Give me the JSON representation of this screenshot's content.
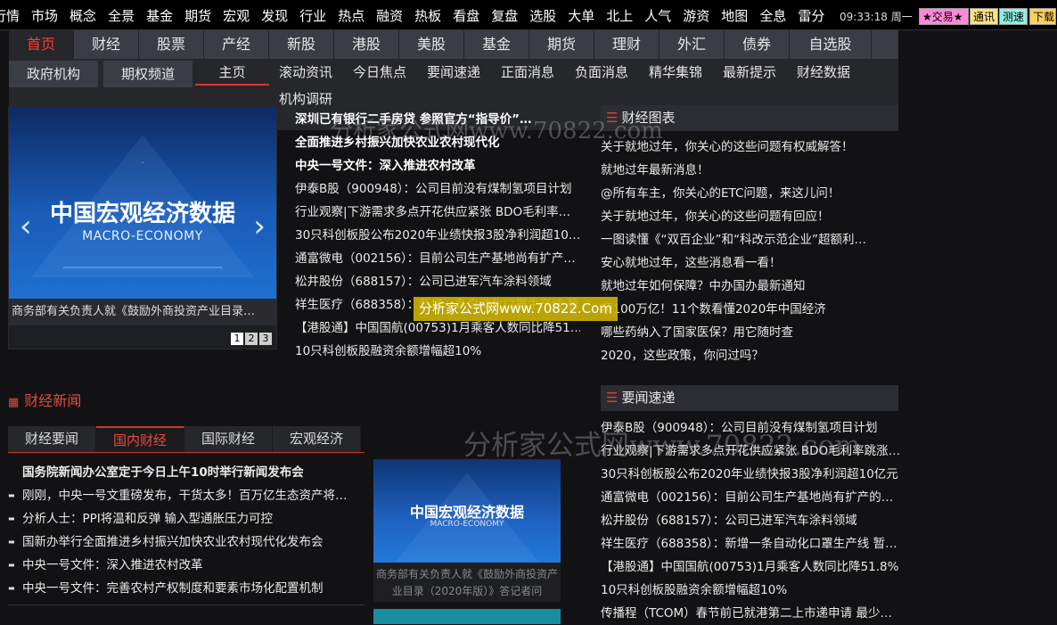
{
  "topbar": {
    "nav": [
      "行情",
      "市场",
      "概念",
      "全景",
      "基金",
      "期货",
      "宏观",
      "发现",
      "行业",
      "热点",
      "融资",
      "热板",
      "看盘",
      "复盘",
      "选股",
      "大单",
      "北上",
      "人气",
      "游资",
      "地图",
      "全息",
      "雷分"
    ],
    "clock": "09:33:18 周一",
    "badges": [
      {
        "label": "★交易★",
        "bg": "#ff88d8"
      },
      {
        "label": "通讯",
        "bg": "#ffe07a"
      },
      {
        "label": "测速",
        "bg": "#8ff0e0"
      },
      {
        "label": "下载",
        "bg": "#ffd060"
      }
    ]
  },
  "main_tabs": [
    "首页",
    "财经",
    "股票",
    "产经",
    "新股",
    "港股",
    "美股",
    "基金",
    "期货",
    "理财",
    "外汇",
    "债券",
    "自选股"
  ],
  "sub_tabs": {
    "box1": "政府机构",
    "box2": "期权频道",
    "items": [
      "主页",
      "滚动资讯",
      "今日焦点",
      "要闻速递",
      "正面消息",
      "负面消息",
      "精华集锦",
      "最新提示",
      "财经数据"
    ],
    "row2": "机构调研"
  },
  "slideshow": {
    "title": "中国宏观经济数据",
    "subtitle": "MACRO-ECONOMY",
    "caption": "商务部有关负责人就《鼓励外商投资产业目录…",
    "pages": [
      "1",
      "2",
      "3"
    ]
  },
  "headlines": [
    {
      "text": "深圳已有银行二手房贷 参照官方“指导价”…",
      "bold": true
    },
    {
      "text": "全面推进乡村振兴加快农业农村现代化",
      "bold": true
    },
    {
      "text": "中央一号文件：深入推进农村改革",
      "bold": true
    },
    {
      "text": "伊泰B股（900948）：公司目前没有煤制氢项目计划",
      "bold": false
    },
    {
      "text": "行业观察|下游需求多点开花供应紧张 BDO毛利率…",
      "bold": false
    },
    {
      "text": "30只科创板股公布2020年业绩快报3股净利润超10…",
      "bold": false
    },
    {
      "text": "通富微电（002156）：目前公司生产基地尚有扩产…",
      "bold": false
    },
    {
      "text": "松井股份（688157）：公司已进军汽车涂料领域",
      "bold": false
    },
    {
      "text": "祥生医疗（688358）：新增一条自动化口罩生产线 暂…",
      "bold": false
    },
    {
      "text": "【港股通】中国国航(00753)1月乘客人数同比降51…",
      "bold": false
    },
    {
      "text": "10只科创板股融资余额增幅超10%",
      "bold": false
    }
  ],
  "charts_section": {
    "title": "财经图表",
    "items": [
      "关于就地过年，你关心的这些问题有权威解答！",
      "就地过年最新消息！",
      "@所有车主，你关心的ETC问题，来这儿问！",
      "关于就地过年，你关心的这些问题有回应！",
      "一图读懂《“双百企业”和“科改示范企业”超额利…",
      "安心就地过年，这些消息看一看！",
      "就地过年如何保障？中办国办最新通知",
      "超100万亿！11个数看懂2020年中国经济",
      "哪些药纳入了国家医保？用它随时查",
      "2020，这些政策，你问过吗？"
    ]
  },
  "express_section": {
    "title": "要闻速递",
    "items": [
      "伊泰B股（900948）：公司目前没有煤制氢项目计划",
      "行业观察|下游需求多点开花供应紧张 BDO毛利率跳涨…",
      "30只科创板股公布2020年业绩快报3股净利润超10亿元",
      "通富微电（002156）：目前公司生产基地尚有扩产的…",
      "松井股份（688157）：公司已进军汽车涂料领域",
      "祥生医疗（688358）：新增一条自动化口罩生产线 暂…",
      "【港股通】中国国航(00753)1月乘客人数同比降51.8%",
      "10只科创板股融资余额增幅超10%",
      "传播程（TCOM）春节前已就港第二上市递申请 最少…"
    ]
  },
  "finance_news": {
    "title": "财经新闻",
    "tabs": [
      "财经要闻",
      "国内财经",
      "国际财经",
      "宏观经济"
    ],
    "items": [
      {
        "text": "国务院新闻办公室定于今日上午10时举行新闻发布会",
        "top": true
      },
      {
        "text": "刚刚，中央一号文重磅发布，干货太多！百万亿生态资产将…",
        "top": false
      },
      {
        "text": "分析人士：PPI将温和反弹 输入型通胀压力可控",
        "top": false
      },
      {
        "text": "国新办举行全面推进乡村振兴加快农业农村现代化发布会",
        "top": false
      },
      {
        "text": "中央一号文件：深入推进农村改革",
        "top": false
      },
      {
        "text": "中央一号文件：完善农村产权制度和要素市场化配置机制",
        "top": false
      }
    ],
    "image": {
      "title": "中国宏观经济数据",
      "subtitle": "MACRO-ECONOMY",
      "caption": "商务部有关负责人就《鼓励外商投资产业目录（2020年版）》答记者问"
    }
  },
  "watermark": {
    "text": "分析家公式网www.70822.com",
    "highlight": "分析家公式网www.70822.Com"
  }
}
